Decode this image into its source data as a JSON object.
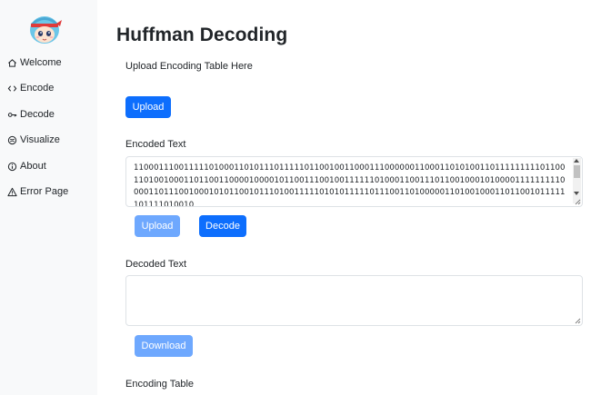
{
  "sidebar": {
    "items": [
      {
        "label": "Welcome",
        "icon": "home-icon"
      },
      {
        "label": "Encode",
        "icon": "code-icon"
      },
      {
        "label": "Decode",
        "icon": "key-icon"
      },
      {
        "label": "Visualize",
        "icon": "visualize-icon"
      },
      {
        "label": "About",
        "icon": "info-icon"
      },
      {
        "label": "Error Page",
        "icon": "warning-icon"
      }
    ]
  },
  "main": {
    "title": "Huffman Decoding",
    "upload_table_label": "Upload Encoding Table Here",
    "upload_table_button": "Upload",
    "encoded_label": "Encoded Text",
    "encoded_text": "110001110011111010001101011101111101100100110001110000001100011010100110111111111011001101001000110110011000010000101100111001001111110100011001110110010001010000111111111000011011100100010101100101110100111110101011111011100110100000110100100011011001011111101111010010",
    "upload_encoded_button": "Upload",
    "decode_button": "Decode",
    "decoded_label": "Decoded Text",
    "decoded_text": "",
    "download_button": "Download",
    "encoding_table_label": "Encoding Table"
  },
  "colors": {
    "primary": "#0d6efd",
    "primary_disabled": "#6ea8fe",
    "sidebar_bg": "#f8f9fa"
  }
}
